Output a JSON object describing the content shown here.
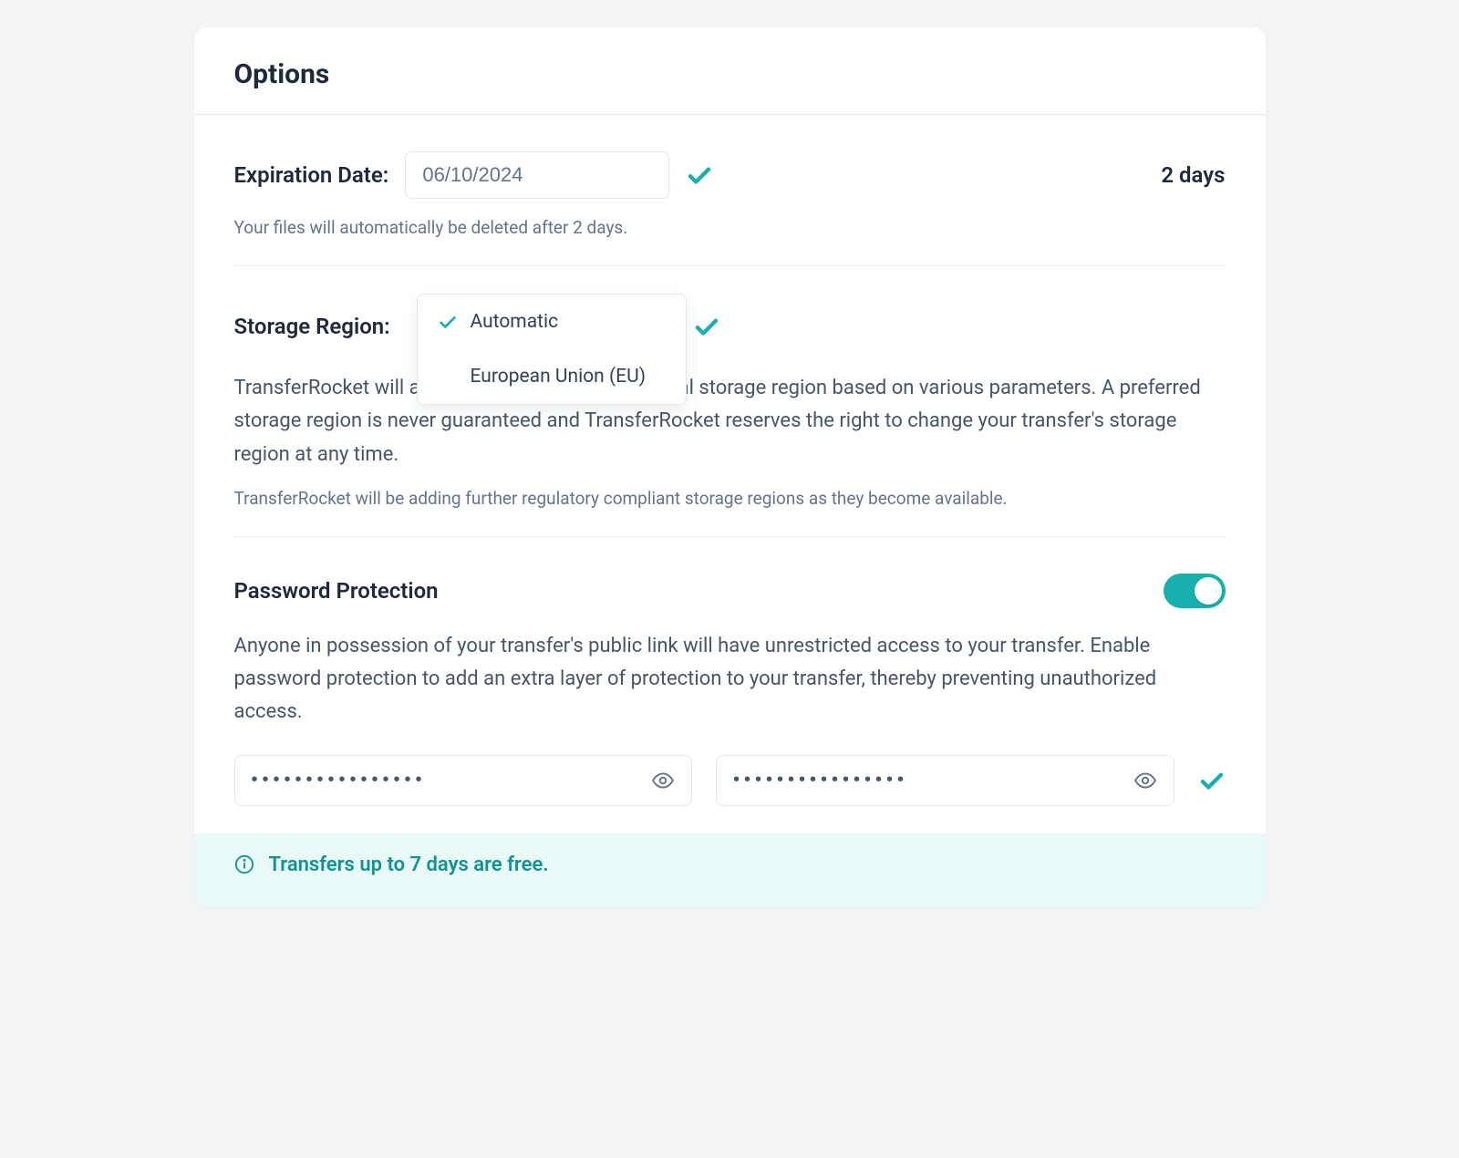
{
  "title": "Options",
  "expiration": {
    "label": "Expiration Date:",
    "value": "06/10/2024",
    "duration": "2 days",
    "hint": "Your files will automatically be deleted after 2 days."
  },
  "region": {
    "label": "Storage Region:",
    "options": [
      {
        "label": "Automatic",
        "selected": true
      },
      {
        "label": "European Union (EU)",
        "selected": false
      }
    ],
    "desc": "TransferRocket will automatically select the optimal storage region based on various parameters. A preferred storage region is never guaranteed and TransferRocket reserves the right to change your transfer's storage region at any time.",
    "subhint": "TransferRocket will be adding further regulatory compliant storage regions as they become available."
  },
  "password": {
    "label": "Password Protection",
    "desc": "Anyone in possession of your transfer's public link will have unrestricted access to your transfer. Enable password protection to add an extra layer of protection to your transfer, thereby preventing unauthorized access.",
    "value1": "••••••••••••••••",
    "value2": "••••••••••••••••"
  },
  "banner": {
    "text": "Transfers up to 7 days are free."
  }
}
